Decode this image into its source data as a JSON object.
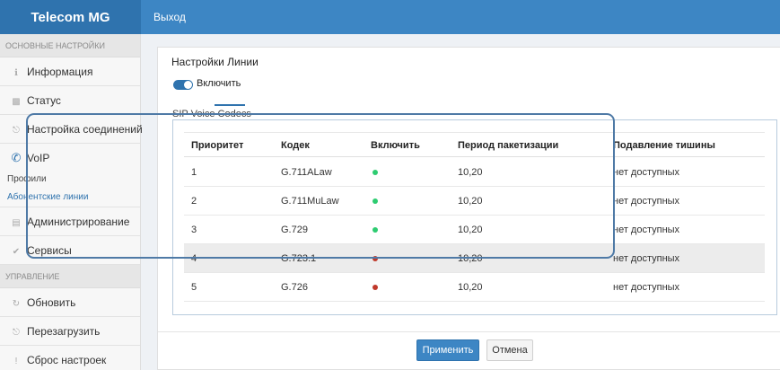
{
  "header": {
    "brand": "Telecom MG",
    "logout": "Выход"
  },
  "sidebar": {
    "section_main": "ОСНОВНЫЕ НАСТРОЙКИ",
    "items": [
      {
        "label": "Информация",
        "icon": "info-icon"
      },
      {
        "label": "Статус",
        "icon": "chart-icon"
      },
      {
        "label": "Настройка соединений",
        "icon": "plug-icon"
      },
      {
        "label": "VoIP",
        "icon": "phone-icon"
      }
    ],
    "voip_sub": [
      {
        "label": "Профили"
      },
      {
        "label": "Абонентские линии",
        "active": true
      }
    ],
    "items2": [
      {
        "label": "Администрирование",
        "icon": "admin-icon"
      },
      {
        "label": "Сервисы",
        "icon": "wrench-icon"
      }
    ],
    "section_manage": "УПРАВЛЕНИЕ",
    "manage_items": [
      {
        "label": "Обновить",
        "icon": "refresh-icon"
      },
      {
        "label": "Перезагрузить",
        "icon": "power-icon"
      },
      {
        "label": "Сброс настроек",
        "icon": "exclamation-icon"
      }
    ]
  },
  "panel": {
    "title": "Настройки Линии",
    "toggle_label": "Включить",
    "toggle_on": true,
    "tab": "SIP Voice Codecs",
    "accent_color": "#2f73ae",
    "table": {
      "headers": [
        "Приоритет",
        "Кодек",
        "Включить",
        "Период пакетизации",
        "Подавление тишины"
      ],
      "rows": [
        {
          "priority": "1",
          "codec": "G.711ALaw",
          "enabled": true,
          "period": "10,20",
          "silence": "нет доступных"
        },
        {
          "priority": "2",
          "codec": "G.711MuLaw",
          "enabled": true,
          "period": "10,20",
          "silence": "нет доступных"
        },
        {
          "priority": "3",
          "codec": "G.729",
          "enabled": true,
          "period": "10,20",
          "silence": "нет доступных"
        },
        {
          "priority": "4",
          "codec": "G.723.1",
          "enabled": false,
          "period": "10,20",
          "silence": "нет доступных"
        },
        {
          "priority": "5",
          "codec": "G.726",
          "enabled": false,
          "period": "10,20",
          "silence": "нет доступных"
        }
      ]
    },
    "apply_label": "Применить",
    "cancel_label": "Отмена"
  }
}
